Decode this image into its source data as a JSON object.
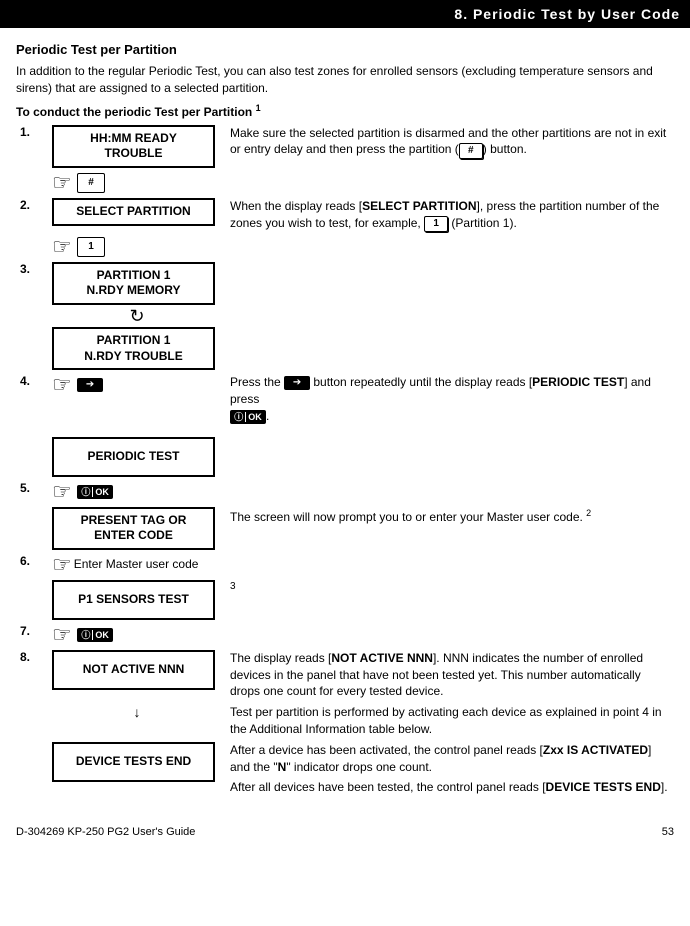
{
  "header": {
    "chapter": "8. Periodic Test by User Code"
  },
  "section": {
    "title": "Periodic Test per Partition",
    "intro": "In addition to the regular Periodic Test, you can also test zones for enrolled sensors (excluding temperature sensors and sirens) that are assigned to a selected partition.",
    "procTitle": "To conduct the periodic Test per Partition",
    "procSup": "1"
  },
  "steps": {
    "s1": {
      "num": "1.",
      "display": "HH:MM READY\nTROUBLE",
      "descA": "Make sure the selected partition is disarmed and the other partitions are not in exit or entry delay and then press the partition (",
      "descB": ") button.",
      "key": "#"
    },
    "s1act": {
      "key": "#"
    },
    "s2": {
      "num": "2.",
      "display": "SELECT PARTITION",
      "descA": "When the display reads [",
      "descBold": "SELECT PARTITION",
      "descB": "], press the partition number of the zones you wish to test, for example, ",
      "descC": " (Partition 1).",
      "key": "1"
    },
    "s2act": {
      "key": "1"
    },
    "s3": {
      "num": "3.",
      "displayA": "PARTITION 1\nN.RDY MEMORY",
      "displayB": "PARTITION 1\nN.RDY TROUBLE"
    },
    "s4": {
      "num": "4.",
      "descA": "Press the ",
      "descB": " button repeatedly until the display reads [",
      "descBold": "PERIODIC TEST",
      "descC": "] and press ",
      "displayBelow": "PERIODIC TEST"
    },
    "s5": {
      "num": "5."
    },
    "s5b": {
      "display": "PRESENT TAG OR\nENTER CODE",
      "descA": "The screen will now prompt you to or enter your Master user code. ",
      "sup": "2"
    },
    "s6": {
      "num": "6.",
      "action": "Enter Master user code",
      "display": "P1 SENSORS TEST",
      "sup": "3"
    },
    "s7": {
      "num": "7."
    },
    "s8": {
      "num": "8.",
      "display": "NOT ACTIVE NNN",
      "p1a": "The display reads [",
      "p1bold": "NOT ACTIVE NNN",
      "p1b": "]. NNN indicates the number of enrolled devices in the panel that have not been tested yet. This number automatically drops one count for every tested device.",
      "p2": "Test per partition is performed by activating each device as explained in point 4 in the Additional Information table below.",
      "p3a": "After a device has been activated, the control panel reads [",
      "p3bold": "Zxx IS ACTIVATED",
      "p3b": "] and the \"",
      "p3boldN": "N",
      "p3c": "\" indicator drops one count.",
      "p4a": "After all devices have been tested, the control panel reads [",
      "p4bold": "DEVICE TESTS END",
      "p4b": "].",
      "displayEnd": "DEVICE TESTS END"
    }
  },
  "footer": {
    "left": "D-304269 KP-250 PG2 User's Guide",
    "right": "53"
  },
  "icons": {
    "okText": "OK",
    "infoSym": "ⓘ"
  }
}
